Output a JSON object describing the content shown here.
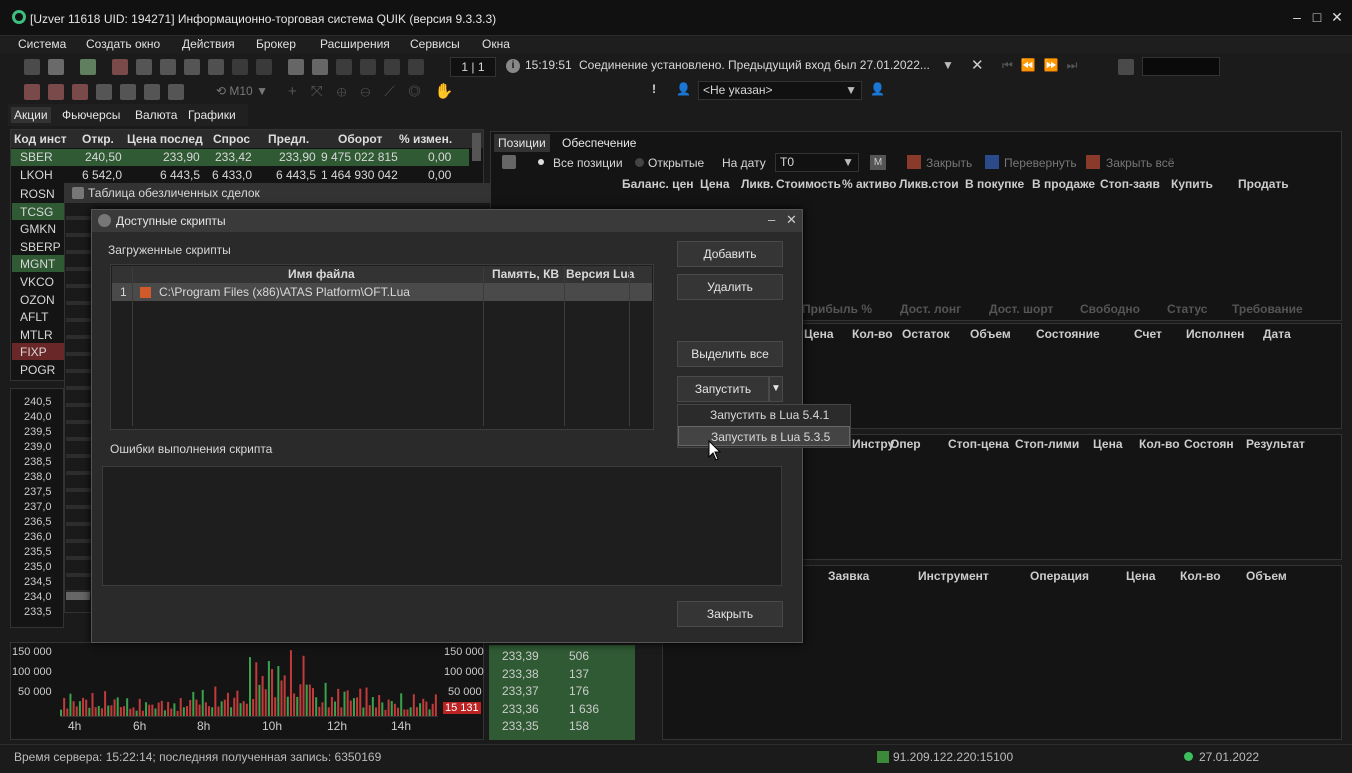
{
  "window": {
    "title": "[Uzver 11618 UID: 194271] Информационно-торговая система QUIK (версия 9.3.3.3)"
  },
  "menu": [
    "Система",
    "Создать окно",
    "Действия",
    "Брокер",
    "Расширения",
    "Сервисы",
    "Окна"
  ],
  "toolbar": {
    "page": "1 | 1",
    "time": "15:19:51",
    "message": "Соединение установлено. Предыдущий вход был 27.01.2022...",
    "interval": "M10",
    "account": "<Не указан>"
  },
  "tabs": [
    "Акции",
    "Фьючерсы",
    "Валюта",
    "Графики"
  ],
  "quotes": {
    "headers": [
      "Код инст",
      "Откр.",
      "Цена послед",
      "Спрос",
      "Предл.",
      "Оборот",
      "% измен."
    ],
    "rows": [
      {
        "code": "SBER",
        "open": "240,50",
        "last": "233,90",
        "bid": "233,42",
        "ask": "233,90",
        "turnover": "9 475 022 815",
        "change": "0,00"
      },
      {
        "code": "LKOH",
        "open": "6 542,0",
        "last": "6 443,5",
        "bid": "6 433,0",
        "ask": "6 443,5",
        "turnover": "1 464 930 042",
        "change": "0,00"
      }
    ],
    "codes": [
      "ROSN",
      "TCSG",
      "GMKN",
      "SBERP",
      "MGNT",
      "VKCO",
      "OZON",
      "AFLT",
      "MTLR",
      "FIXP",
      "POGR"
    ]
  },
  "trades_window": {
    "title": "Таблица обезличенных сделок"
  },
  "price_scale": [
    "240,5",
    "240,0",
    "239,5",
    "239,0",
    "238,5",
    "238,0",
    "237,5",
    "237,0",
    "236,5",
    "236,0",
    "235,5",
    "235,0",
    "234,5",
    "234,0",
    "233,5"
  ],
  "volume_chart": {
    "left_ticks": [
      "150 000",
      "100 000",
      "50 000"
    ],
    "right_ticks": [
      "150 000",
      "100 000",
      "50 000"
    ],
    "current": "15 131",
    "x_ticks": [
      "4h",
      "6h",
      "8h",
      "10h",
      "12h",
      "14h"
    ]
  },
  "chart_data": {
    "type": "bar",
    "title": "",
    "xlabel": "",
    "ylabel": "",
    "ylim": [
      0,
      170000
    ],
    "categories": [
      "4h",
      "6h",
      "8h",
      "10h",
      "12h",
      "14h"
    ],
    "values": [
      60000,
      45000,
      70000,
      160000,
      80000,
      55000
    ]
  },
  "orderbook": [
    {
      "price": "233,39",
      "qty": "506"
    },
    {
      "price": "233,38",
      "qty": "137"
    },
    {
      "price": "233,37",
      "qty": "176"
    },
    {
      "price": "233,36",
      "qty": "1 636"
    },
    {
      "price": "233,35",
      "qty": "158"
    }
  ],
  "positions": {
    "tabs": [
      "Позиции",
      "Обеспечение"
    ],
    "filter": {
      "all": "Все позиции",
      "open": "Открытые",
      "date_label": "На дату",
      "date": "T0",
      "close": "Закрыть",
      "reverse": "Перевернуть",
      "close_all": "Закрыть всё",
      "m": "M"
    },
    "headers": [
      "Баланс. цен",
      "Цена",
      "Ликв.",
      "Стоимость",
      "% активо",
      "Ликв.стои",
      "В покупке",
      "В продаже",
      "Стоп-заяв",
      "Купить",
      "Продать"
    ],
    "footer": [
      "Прибыль %",
      "Дост. лонг",
      "Дост. шорт",
      "Свободно",
      "Статус",
      "Требование"
    ]
  },
  "orders": {
    "headers": [
      "Цена",
      "Кол-во",
      "Остаток",
      "Объем",
      "Состояние",
      "Счет",
      "Исполнен",
      "Дата"
    ]
  },
  "stops": {
    "headers": [
      "Инстру",
      "Опер",
      "Стоп-цена",
      "Стоп-лими",
      "Цена",
      "Кол-во",
      "Состоян",
      "Результат"
    ]
  },
  "deals": {
    "headers": [
      "Заявка",
      "Инструмент",
      "Операция",
      "Цена",
      "Кол-во",
      "Объем"
    ]
  },
  "dialog": {
    "title": "Доступные скрипты",
    "loaded_label": "Загруженные скрипты",
    "columns": [
      "Имя файла",
      "Память, КВ",
      "Версия Lua"
    ],
    "scripts": [
      {
        "num": "1",
        "file": "C:\\Program Files (x86)\\ATAS Platform\\OFT.Lua",
        "memory": "",
        "version": ""
      }
    ],
    "errors_label": "Ошибки выполнения скрипта",
    "buttons": {
      "add": "Добавить",
      "delete": "Удалить",
      "select_all": "Выделить все",
      "run": "Запустить",
      "close": "Закрыть"
    },
    "run_menu": [
      "Запустить в Lua 5.4.1",
      "Запустить в Lua 5.3.5"
    ]
  },
  "status": {
    "server": "Время сервера: 15:22:14; последняя полученная запись: 6350169",
    "ip": "91.209.122.220:15100",
    "date": "27.01.2022"
  }
}
